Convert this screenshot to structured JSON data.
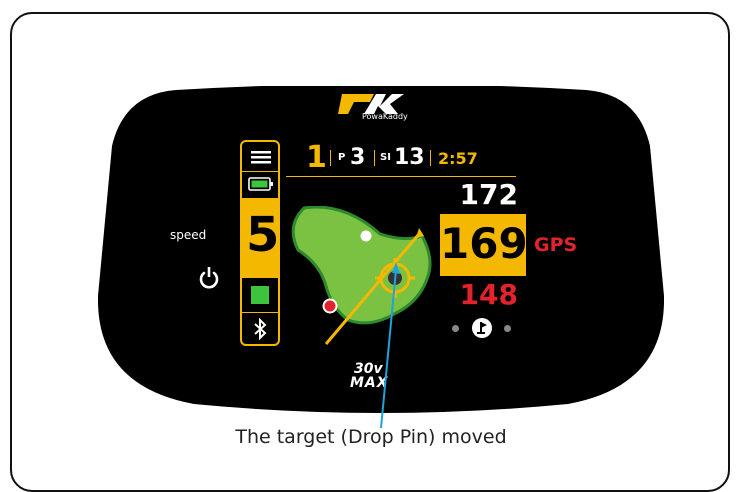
{
  "brand": {
    "logo_text": "PowaKaddy",
    "model_top": "30v",
    "model_bottom": "MAX"
  },
  "status_row": {
    "hole": "1",
    "par_label": "P",
    "par_value": "3",
    "si_label": "SI",
    "si_value": "13",
    "time": "2:57"
  },
  "distances": {
    "back": "172",
    "center": "169",
    "front": "148",
    "mode": "GPS"
  },
  "left_panel": {
    "speed_label": "speed",
    "speed_value": "5"
  },
  "caption": "The target (Drop Pin) moved",
  "colors": {
    "accent": "#f5b800",
    "distance_red": "#e2232b",
    "green_fill": "#7cc242",
    "screen": "#000000",
    "annotation_arrow": "#1fa3d9"
  },
  "icons": [
    "menu-icon",
    "battery-icon",
    "stop-icon",
    "bluetooth-icon",
    "power-icon",
    "flag-icon",
    "target-icon"
  ]
}
